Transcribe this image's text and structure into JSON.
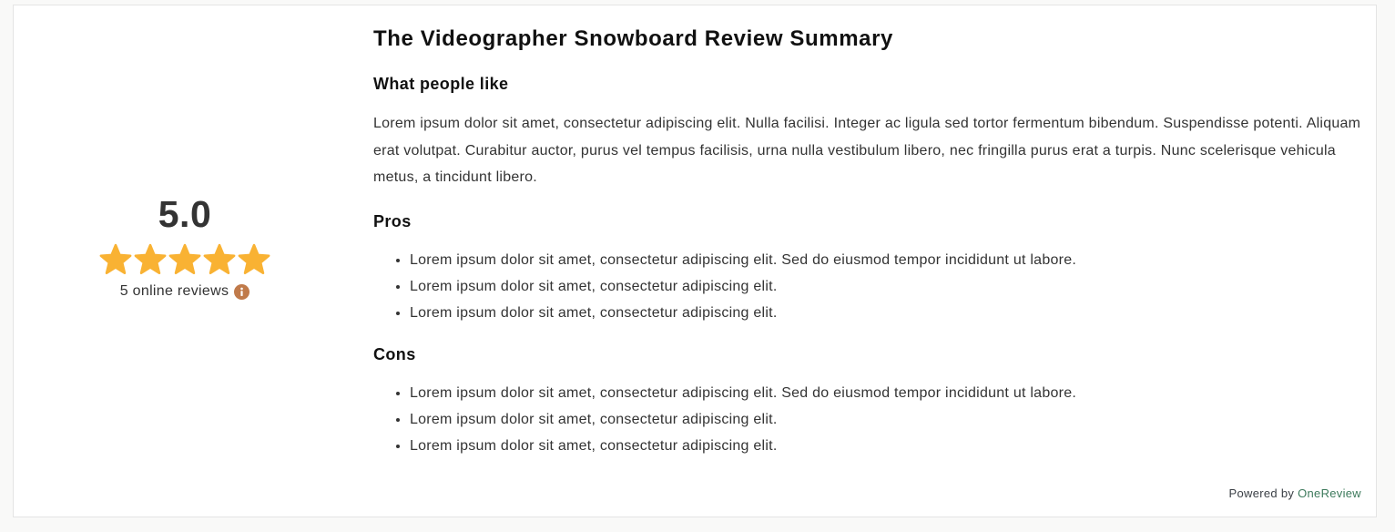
{
  "rating": {
    "value": "5.0",
    "stars_filled": 5,
    "stars_total": 5,
    "reviews_label": "5 online reviews",
    "star_color": "#f9b233",
    "info_icon_color": "#c07a4a"
  },
  "summary": {
    "title": "The Videographer Snowboard Review Summary",
    "like_heading": "What people like",
    "like_text": "Lorem ipsum dolor sit amet, consectetur adipiscing elit. Nulla facilisi. Integer ac ligula sed tortor fermentum bibendum. Suspendisse potenti. Aliquam erat volutpat. Curabitur auctor, purus vel tempus facilisis, urna nulla vestibulum libero, nec fringilla purus erat a turpis. Nunc scelerisque vehicula metus, a tincidunt libero.",
    "pros_heading": "Pros",
    "pros": [
      "Lorem ipsum dolor sit amet, consectetur adipiscing elit. Sed do eiusmod tempor incididunt ut labore.",
      "Lorem ipsum dolor sit amet, consectetur adipiscing elit.",
      "Lorem ipsum dolor sit amet, consectetur adipiscing elit."
    ],
    "cons_heading": "Cons",
    "cons": [
      "Lorem ipsum dolor sit amet, consectetur adipiscing elit. Sed do eiusmod tempor incididunt ut labore.",
      "Lorem ipsum dolor sit amet, consectetur adipiscing elit.",
      "Lorem ipsum dolor sit amet, consectetur adipiscing elit."
    ]
  },
  "footer": {
    "powered_prefix": "Powered by",
    "brand": "OneReview",
    "brand_color": "#3d7a5c"
  }
}
